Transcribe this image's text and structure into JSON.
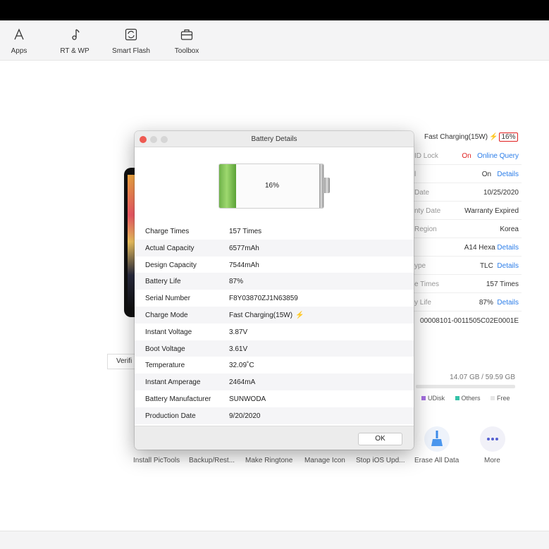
{
  "toolbar": {
    "items": [
      {
        "label": "Apps",
        "icon": "apps-icon"
      },
      {
        "label": "RT & WP",
        "icon": "music-note-icon"
      },
      {
        "label": "Smart Flash",
        "icon": "flash-icon"
      },
      {
        "label": "Toolbox",
        "icon": "toolbox-icon"
      }
    ]
  },
  "background": {
    "fast_charging": "Fast Charging(15W)",
    "battery_badge": "16%",
    "verify_label": "Verifi",
    "info_rows": [
      {
        "label": "ID Lock",
        "value": "On",
        "link": "Online Query"
      },
      {
        "label": "l",
        "value": "On",
        "link": "Details"
      },
      {
        "label": "Date",
        "value": "10/25/2020",
        "link": ""
      },
      {
        "label": "nty Date",
        "value": "Warranty Expired",
        "link": ""
      },
      {
        "label": "Region",
        "value": "Korea",
        "link": ""
      },
      {
        "label": "",
        "value": "A14 Hexa",
        "link": "Details"
      },
      {
        "label": "ype",
        "value": "TLC",
        "link": "Details"
      },
      {
        "label": "e Times",
        "value": "157 Times",
        "link": ""
      },
      {
        "label": "y Life",
        "value": "87%",
        "link": "Details"
      },
      {
        "label": "",
        "value": "00008101-0011505C02E0001E",
        "link": ""
      }
    ],
    "storage": {
      "used": "14.07 GB / 59.59 GB"
    },
    "legend": [
      {
        "label": "UDisk",
        "color": "#a46fe0"
      },
      {
        "label": "Others",
        "color": "#35c2a8"
      },
      {
        "label": "Free",
        "color": "#e6e6e6"
      }
    ],
    "tools": [
      {
        "label": "Install PicTools"
      },
      {
        "label": "Backup/Rest..."
      },
      {
        "label": "Make Ringtone"
      },
      {
        "label": "Manage Icon"
      },
      {
        "label": "Stop iOS Upd..."
      },
      {
        "label": "Erase All Data",
        "icon": "broom-icon"
      },
      {
        "label": "More",
        "icon": "more-icon"
      }
    ]
  },
  "dialog": {
    "title": "Battery Details",
    "battery_percent": "16%",
    "battery_level": 0.16,
    "rows": [
      {
        "key": "Charge Times",
        "value": "157 Times"
      },
      {
        "key": "Actual Capacity",
        "value": "6577mAh"
      },
      {
        "key": "Design Capacity",
        "value": "7544mAh"
      },
      {
        "key": "Battery Life",
        "value": "87%"
      },
      {
        "key": "Serial Number",
        "value": "F8Y03870ZJ1N63859"
      },
      {
        "key": "Charge Mode",
        "value": "Fast Charging(15W)"
      },
      {
        "key": "Instant Voltage",
        "value": "3.87V"
      },
      {
        "key": "Boot Voltage",
        "value": "3.61V"
      },
      {
        "key": "Temperature",
        "value": "32.09˚C"
      },
      {
        "key": "Instant Amperage",
        "value": "2464mA"
      },
      {
        "key": "Battery Manufacturer",
        "value": "SUNWODA"
      },
      {
        "key": "Production Date",
        "value": "9/20/2020"
      }
    ],
    "ok_label": "OK"
  }
}
